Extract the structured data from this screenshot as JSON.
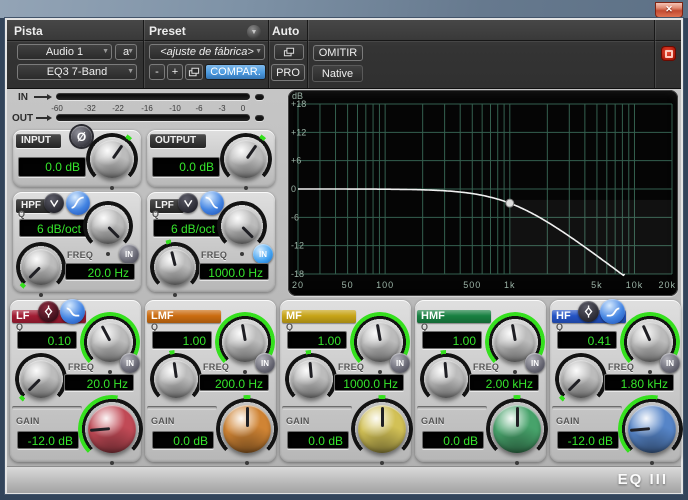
{
  "icons": {
    "close_glyph": "✕",
    "dropdown_glyph": "▼",
    "phase_glyph": "Ø"
  },
  "header": {
    "track_section_label": "Pista",
    "track_selector": "Audio 1",
    "automation_selector": "a",
    "plugin_selector": "EQ3 7-Band",
    "preset_section_label": "Preset",
    "preset_selector": "<ajuste de fábrica>",
    "preset_decrement": "-",
    "preset_increment": "+",
    "compare_button": "COMPAR.",
    "auto_section_label": "Auto",
    "pro_button": "PRO",
    "bypass_button": "OMITIR",
    "processing_mode": "Native"
  },
  "meters": {
    "in_label": "IN",
    "out_label": "OUT",
    "scale_ticks": [
      "-60",
      "-32",
      "-22",
      "-16",
      "-10",
      "-6",
      "-3",
      "0"
    ]
  },
  "io": {
    "input": {
      "label": "INPUT",
      "gain_value": "0.0 dB"
    },
    "output": {
      "label": "OUTPUT",
      "gain_value": "0.0 dB"
    }
  },
  "filters": {
    "hpf": {
      "label": "HPF",
      "q_label": "Q",
      "slope_value": "6 dB/oct",
      "freq_label": "FREQ",
      "freq_value": "20.0 Hz",
      "in_label": "IN",
      "engaged": false
    },
    "lpf": {
      "label": "LPF",
      "q_label": "Q",
      "slope_value": "6 dB/oct",
      "freq_label": "FREQ",
      "freq_value": "1000.0 Hz",
      "in_label": "IN",
      "engaged": true
    }
  },
  "band_labels": {
    "q": "Q",
    "freq": "FREQ",
    "gain": "GAIN",
    "in": "IN"
  },
  "bands": [
    {
      "label": "LF",
      "q_value": "0.10",
      "freq_value": "20.0 Hz",
      "gain_value": "-12.0 dB",
      "strip_color": "#a21d34",
      "knob_color": "#c14a56",
      "engaged": false,
      "has_shape_buttons": true
    },
    {
      "label": "LMF",
      "q_value": "1.00",
      "freq_value": "200.0 Hz",
      "gain_value": "0.0 dB",
      "strip_color": "#cb6c10",
      "knob_color": "#d08434",
      "engaged": false,
      "has_shape_buttons": false
    },
    {
      "label": "MF",
      "q_value": "1.00",
      "freq_value": "1000.0 Hz",
      "gain_value": "0.0 dB",
      "strip_color": "#c7a417",
      "knob_color": "#d2c156",
      "engaged": false,
      "has_shape_buttons": false
    },
    {
      "label": "HMF",
      "q_value": "1.00",
      "freq_value": "2.00 kHz",
      "gain_value": "0.0 dB",
      "strip_color": "#188041",
      "knob_color": "#47a36b",
      "engaged": false,
      "has_shape_buttons": false
    },
    {
      "label": "HF",
      "q_value": "0.41",
      "freq_value": "1.80 kHz",
      "gain_value": "-12.0 dB",
      "strip_color": "#2454c5",
      "knob_color": "#5685c8",
      "engaged": false,
      "has_shape_buttons": true
    }
  ],
  "graph": {
    "y_unit_label": "dB",
    "y_ticks": [
      {
        "label": "+18",
        "db": 18
      },
      {
        "label": "+12",
        "db": 12
      },
      {
        "label": "+6",
        "db": 6
      },
      {
        "label": "0",
        "db": 0
      },
      {
        "label": "-6",
        "db": -6
      },
      {
        "label": "-12",
        "db": -12
      },
      {
        "label": "-18",
        "db": -18
      }
    ],
    "x_ticks": [
      {
        "label": "20",
        "hz": 20
      },
      {
        "label": "50",
        "hz": 50
      },
      {
        "label": "100",
        "hz": 100
      },
      {
        "label": "500",
        "hz": 500
      },
      {
        "label": "1k",
        "hz": 1000
      },
      {
        "label": "5k",
        "hz": 5000
      },
      {
        "label": "10k",
        "hz": 10000
      },
      {
        "label": "20k",
        "hz": 20000
      }
    ],
    "db_range": [
      -18,
      18
    ],
    "freq_range_hz": [
      20,
      20000
    ],
    "curve": {
      "type": "lowpass",
      "cutoff_hz": 1000,
      "slope_db_per_oct": 6,
      "handle": {
        "freq_hz": 1000,
        "gain_db": -3
      }
    },
    "grid_color": "#34604f",
    "curve_color": "#f0f0f0",
    "label_color": "#9cb4a7",
    "background": "#050505"
  },
  "footer": {
    "logo": "EQ III"
  },
  "colors": {
    "lcd_text": "#36e52c",
    "compare_active": "#4c9be0",
    "engaged_blue": "#3fa0f0"
  }
}
